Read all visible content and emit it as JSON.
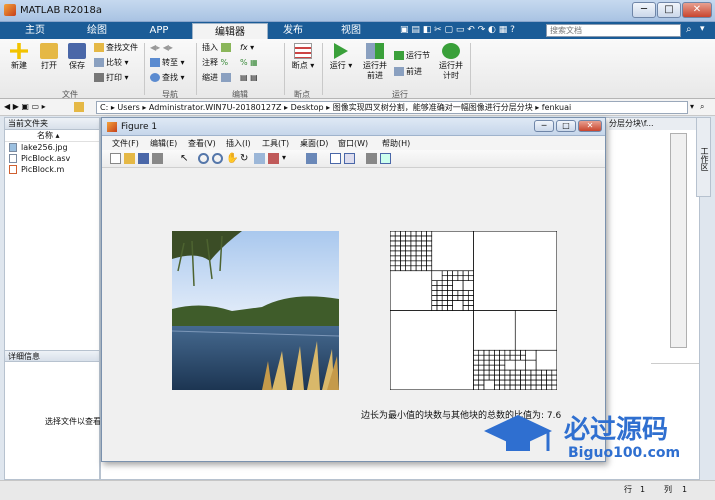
{
  "app": {
    "title": "MATLAB R2018a"
  },
  "tabs": [
    "主页",
    "绘图",
    "APP",
    "编辑器",
    "发布",
    "视图"
  ],
  "search": {
    "placeholder": "搜索文档"
  },
  "ribbon": {
    "new": "新建",
    "open": "打开",
    "save": "保存",
    "find_files": "查找文件",
    "compare": "比较",
    "print": "打印",
    "insert": "插入",
    "comment": "注释",
    "indent": "缩进",
    "goto": "转至",
    "find": "查找",
    "breakpoints": "断点",
    "run": "运行",
    "run_advance_l1": "运行并",
    "run_advance_l2": "前进",
    "run_section": "运行节",
    "advance": "前进",
    "run_time_l1": "运行并",
    "run_time_l2": "计时",
    "groups": {
      "file": "文件",
      "navigate": "导航",
      "edit": "编辑",
      "breakpoints": "断点",
      "run": "运行"
    }
  },
  "path": {
    "segments": "C: ▸ Users ▸ Administrator.WIN7U-20180127Z ▸ Desktop ▸ 图像实现四叉树分割，能够准确对一幅图像进行分层分块 ▸ fenkuai"
  },
  "left_panel": {
    "title": "当前文件夹",
    "column": "名称 ▴",
    "files": [
      "lake256.jpg",
      "PicBlock.asv",
      "PicBlock.m"
    ],
    "details_title": "详细信息",
    "details_text": "选择文件以查看"
  },
  "behind_tab": "分层分块\\f...",
  "right_vtab": "工作区",
  "status": {
    "row_label": "行",
    "row": "1",
    "col_label": "列",
    "col": "1"
  },
  "figure": {
    "title": "Figure 1",
    "menus": [
      "文件(F)",
      "编辑(E)",
      "查看(V)",
      "插入(I)",
      "工具(T)",
      "桌面(D)",
      "窗口(W)",
      "帮助(H)"
    ],
    "caption": "边长为最小值的块数与其他块的总数的比值为: 7.6"
  },
  "watermark": {
    "name": "必过源码",
    "url": "Biguo100.com"
  },
  "colors": {
    "tabbar": "#1b5c97",
    "ribbon": "#f3f3f3"
  }
}
